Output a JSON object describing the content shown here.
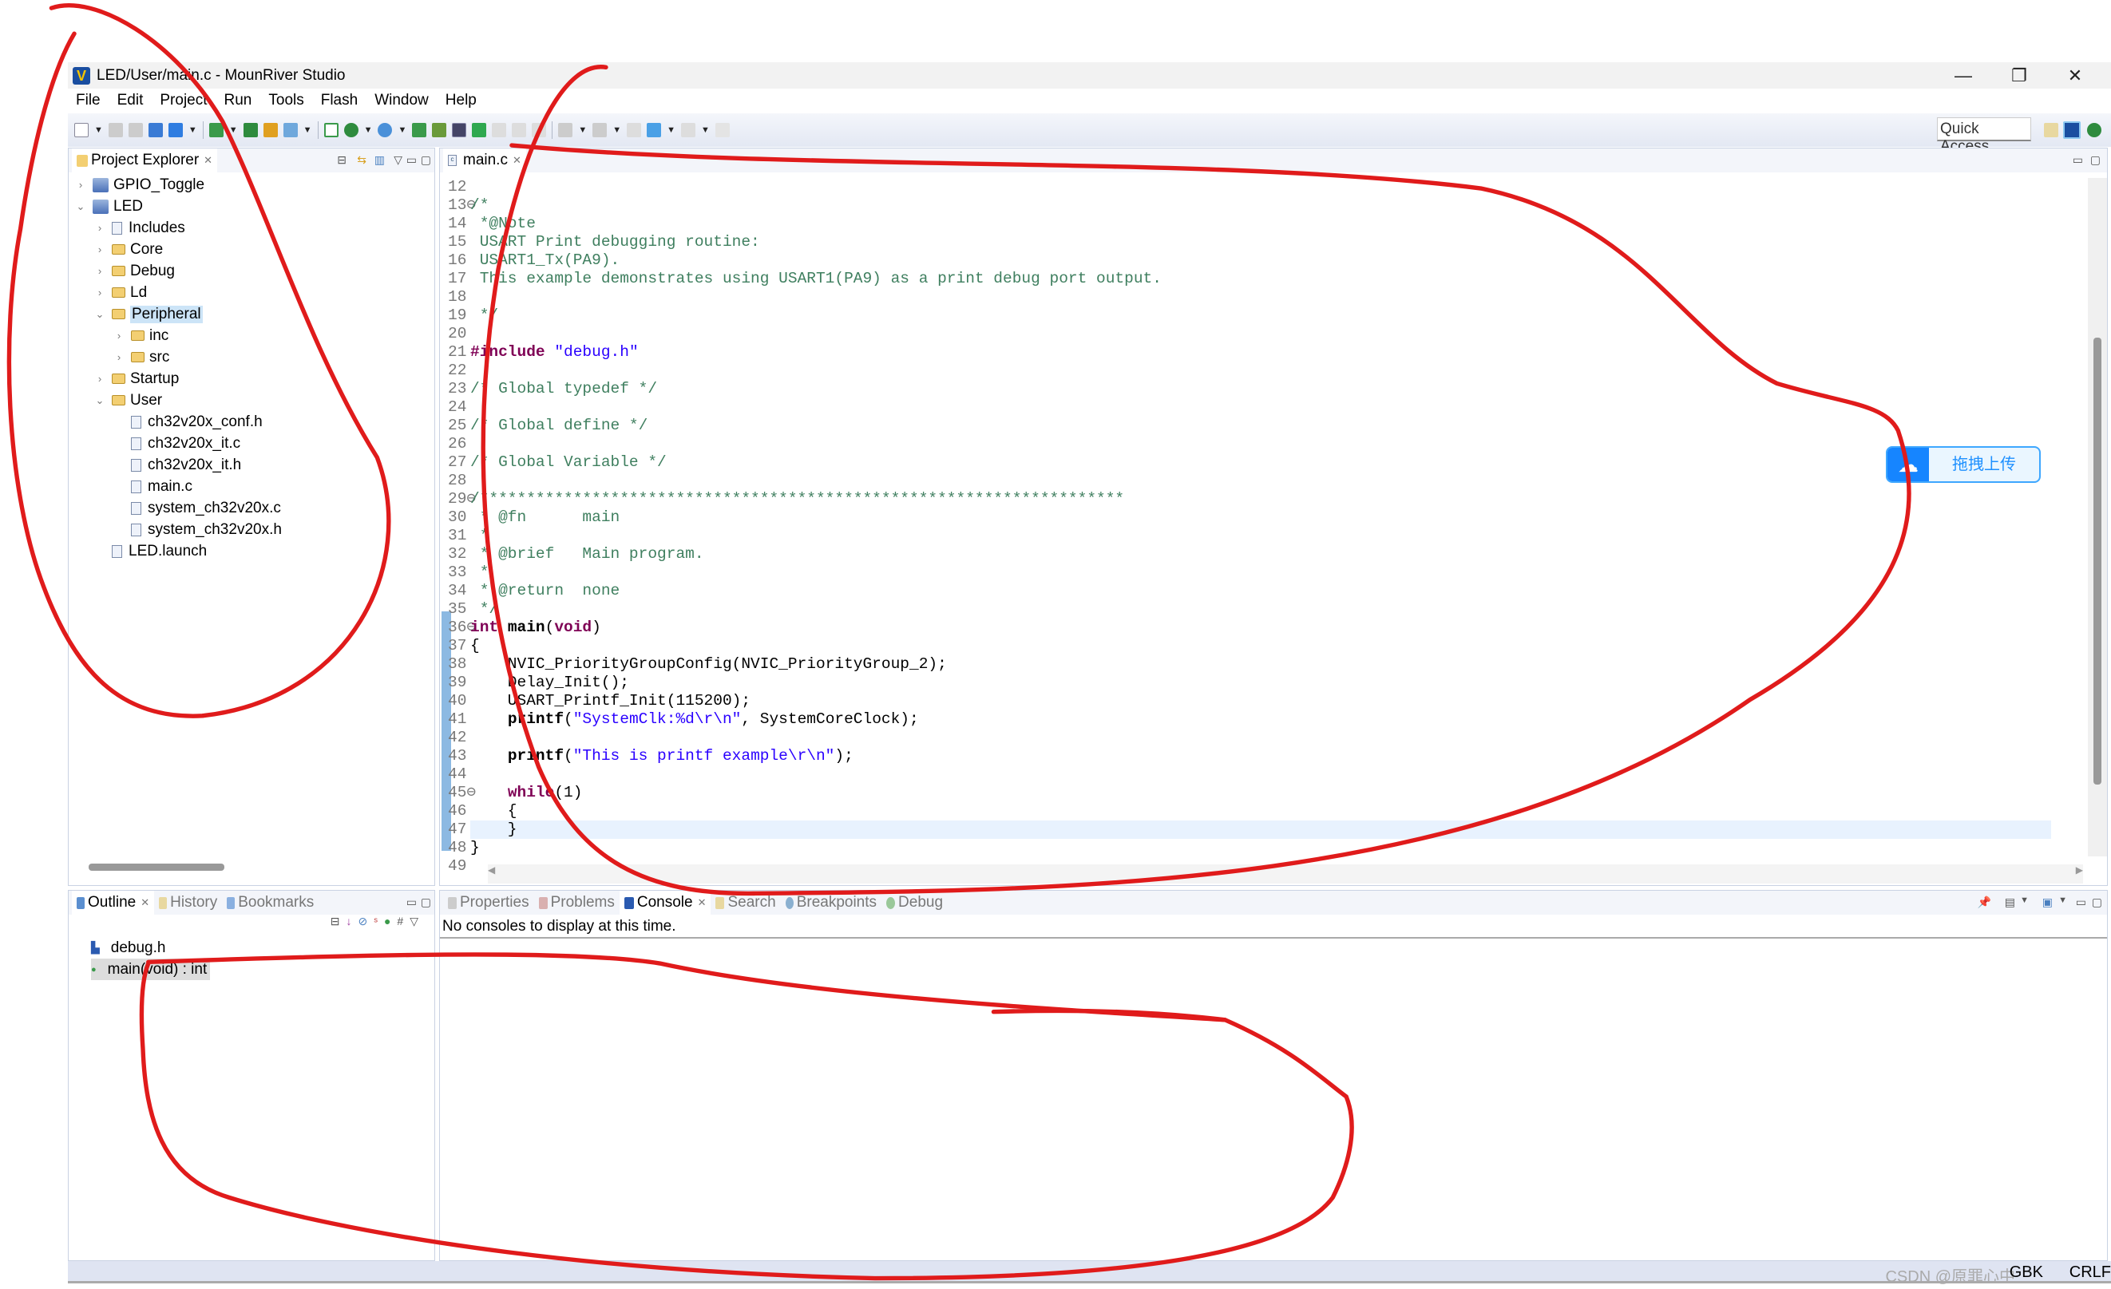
{
  "window": {
    "title": "LED/User/main.c - MounRiver Studio",
    "minimize": "—",
    "restore": "❐",
    "close": "✕"
  },
  "menu": [
    "File",
    "Edit",
    "Project",
    "Run",
    "Tools",
    "Flash",
    "Window",
    "Help"
  ],
  "toolbar": {
    "quick_access": "Quick Access"
  },
  "project_explorer": {
    "tab": "Project Explorer",
    "tree": [
      {
        "label": "GPIO_Toggle",
        "depth": 0,
        "type": "project",
        "chevron": "›"
      },
      {
        "label": "LED",
        "depth": 0,
        "type": "project",
        "chevron": "⌄"
      },
      {
        "label": "Includes",
        "depth": 1,
        "type": "includes",
        "chevron": "›"
      },
      {
        "label": "Core",
        "depth": 1,
        "type": "folder",
        "chevron": "›"
      },
      {
        "label": "Debug",
        "depth": 1,
        "type": "folder",
        "chevron": "›"
      },
      {
        "label": "Ld",
        "depth": 1,
        "type": "folder",
        "chevron": "›"
      },
      {
        "label": "Peripheral",
        "depth": 1,
        "type": "folder",
        "chevron": "⌄",
        "selected": true
      },
      {
        "label": "inc",
        "depth": 2,
        "type": "folder",
        "chevron": "›"
      },
      {
        "label": "src",
        "depth": 2,
        "type": "folder",
        "chevron": "›"
      },
      {
        "label": "Startup",
        "depth": 1,
        "type": "folder",
        "chevron": "›"
      },
      {
        "label": "User",
        "depth": 1,
        "type": "folder",
        "chevron": "⌄"
      },
      {
        "label": "ch32v20x_conf.h",
        "depth": 2,
        "type": "file-h",
        "chevron": ""
      },
      {
        "label": "ch32v20x_it.c",
        "depth": 2,
        "type": "file-c",
        "chevron": ""
      },
      {
        "label": "ch32v20x_it.h",
        "depth": 2,
        "type": "file-h",
        "chevron": ""
      },
      {
        "label": "main.c",
        "depth": 2,
        "type": "file-c",
        "chevron": ""
      },
      {
        "label": "system_ch32v20x.c",
        "depth": 2,
        "type": "file-c",
        "chevron": ""
      },
      {
        "label": "system_ch32v20x.h",
        "depth": 2,
        "type": "file-h",
        "chevron": ""
      },
      {
        "label": "LED.launch",
        "depth": 1,
        "type": "file-launch",
        "chevron": ""
      }
    ]
  },
  "editor": {
    "tab": "main.c",
    "current_line": 47,
    "lines": [
      {
        "n": "12",
        "s": []
      },
      {
        "n": "13⊖",
        "s": [
          {
            "c": "com",
            "t": "/*"
          }
        ]
      },
      {
        "n": "14",
        "s": [
          {
            "c": "com",
            "t": " *@Note"
          }
        ]
      },
      {
        "n": "15",
        "s": [
          {
            "c": "com",
            "t": " USART Print debugging routine:"
          }
        ]
      },
      {
        "n": "16",
        "s": [
          {
            "c": "com",
            "t": " USART1_Tx(PA9)."
          }
        ]
      },
      {
        "n": "17",
        "s": [
          {
            "c": "com",
            "t": " This example demonstrates using USART1(PA9) as a print debug port output."
          }
        ]
      },
      {
        "n": "18",
        "s": []
      },
      {
        "n": "19",
        "s": [
          {
            "c": "com",
            "t": " */"
          }
        ]
      },
      {
        "n": "20",
        "s": []
      },
      {
        "n": "21",
        "s": [
          {
            "c": "kw",
            "t": "#include"
          },
          {
            "c": "pl",
            "t": " "
          },
          {
            "c": "str",
            "t": "\"debug.h\""
          }
        ]
      },
      {
        "n": "22",
        "s": []
      },
      {
        "n": "23",
        "s": [
          {
            "c": "com",
            "t": "/* Global typedef */"
          }
        ]
      },
      {
        "n": "24",
        "s": []
      },
      {
        "n": "25",
        "s": [
          {
            "c": "com",
            "t": "/* Global define */"
          }
        ]
      },
      {
        "n": "26",
        "s": []
      },
      {
        "n": "27",
        "s": [
          {
            "c": "com",
            "t": "/* Global Variable */"
          }
        ]
      },
      {
        "n": "28",
        "s": []
      },
      {
        "n": "29⊖",
        "s": [
          {
            "c": "com",
            "t": "/*********************************************************************"
          }
        ]
      },
      {
        "n": "30",
        "s": [
          {
            "c": "com",
            "t": " * @fn      main"
          }
        ]
      },
      {
        "n": "31",
        "s": [
          {
            "c": "com",
            "t": " *"
          }
        ]
      },
      {
        "n": "32",
        "s": [
          {
            "c": "com",
            "t": " * @brief   Main program."
          }
        ]
      },
      {
        "n": "33",
        "s": [
          {
            "c": "com",
            "t": " *"
          }
        ]
      },
      {
        "n": "34",
        "s": [
          {
            "c": "com",
            "t": " * @return  none"
          }
        ]
      },
      {
        "n": "35",
        "s": [
          {
            "c": "com",
            "t": " */"
          }
        ]
      },
      {
        "n": "36⊖",
        "s": [
          {
            "c": "kw",
            "t": "int"
          },
          {
            "c": "pl",
            "t": " "
          },
          {
            "c": "bold",
            "t": "main"
          },
          {
            "c": "pl",
            "t": "("
          },
          {
            "c": "kw",
            "t": "void"
          },
          {
            "c": "pl",
            "t": ")"
          }
        ]
      },
      {
        "n": "37",
        "s": [
          {
            "c": "pl",
            "t": "{"
          }
        ]
      },
      {
        "n": "38",
        "s": [
          {
            "c": "pl",
            "t": "    NVIC_PriorityGroupConfig(NVIC_PriorityGroup_2);"
          }
        ]
      },
      {
        "n": "39",
        "s": [
          {
            "c": "pl",
            "t": "    Delay_Init();"
          }
        ]
      },
      {
        "n": "40",
        "s": [
          {
            "c": "pl",
            "t": "    USART_Printf_Init(115200);"
          }
        ]
      },
      {
        "n": "41",
        "s": [
          {
            "c": "pl",
            "t": "    "
          },
          {
            "c": "bold",
            "t": "printf"
          },
          {
            "c": "pl",
            "t": "("
          },
          {
            "c": "str",
            "t": "\"SystemClk:%d\\r\\n\""
          },
          {
            "c": "pl",
            "t": ", SystemCoreClock);"
          }
        ]
      },
      {
        "n": "42",
        "s": []
      },
      {
        "n": "43",
        "s": [
          {
            "c": "pl",
            "t": "    "
          },
          {
            "c": "bold",
            "t": "printf"
          },
          {
            "c": "pl",
            "t": "("
          },
          {
            "c": "str",
            "t": "\"This is printf example\\r\\n\""
          },
          {
            "c": "pl",
            "t": ");"
          }
        ]
      },
      {
        "n": "44",
        "s": []
      },
      {
        "n": "45⊖",
        "s": [
          {
            "c": "pl",
            "t": "    "
          },
          {
            "c": "kw",
            "t": "while"
          },
          {
            "c": "pl",
            "t": "(1)"
          }
        ]
      },
      {
        "n": "46",
        "s": [
          {
            "c": "pl",
            "t": "    {"
          }
        ]
      },
      {
        "n": "47",
        "s": [
          {
            "c": "pl",
            "t": "    }"
          }
        ]
      },
      {
        "n": "48",
        "s": [
          {
            "c": "pl",
            "t": "}"
          }
        ]
      },
      {
        "n": "49",
        "s": []
      }
    ]
  },
  "upload_widget": {
    "label": "拖拽上传",
    "icon": "cloud-icon"
  },
  "outline": {
    "tabs": [
      "Outline",
      "History",
      "Bookmarks"
    ],
    "items": [
      {
        "label": "debug.h",
        "icon": "include-icon"
      },
      {
        "label": "main(void) : int",
        "icon": "function-icon",
        "selected": true
      }
    ]
  },
  "console": {
    "tabs": [
      "Properties",
      "Problems",
      "Console",
      "Search",
      "Breakpoints",
      "Debug"
    ],
    "active_tab": "Console",
    "message": "No consoles to display at this time."
  },
  "status": {
    "encoding": "GBK",
    "line_ending": "CRLF",
    "watermark": "CSDN @原罪心中"
  },
  "colors": {
    "annotation": "#e01b1b",
    "keyword": "#7f0055",
    "comment": "#3f7f5f",
    "string": "#2a00ff",
    "selection": "#cce4f7"
  }
}
